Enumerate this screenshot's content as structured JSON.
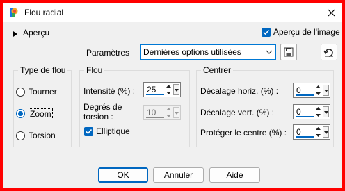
{
  "window": {
    "title": "Flou radial"
  },
  "preview": {
    "label": "Aperçu",
    "image_preview_label": "Aperçu de l'image",
    "image_preview_checked": true
  },
  "params": {
    "label": "Paramètres",
    "preset_value": "Dernières options utilisées"
  },
  "blur_type": {
    "title": "Type de flou",
    "options": [
      {
        "label": "Tourner",
        "checked": false
      },
      {
        "label": "Zoom",
        "checked": true
      },
      {
        "label": "Torsion",
        "checked": false
      }
    ]
  },
  "blur": {
    "title": "Flou",
    "intensity_label": "Intensité (%) :",
    "intensity_value": "25",
    "torsion_label_1": "Degrés de",
    "torsion_label_2": "torsion :",
    "torsion_value": "10",
    "elliptical_label": "Elliptique",
    "elliptical_checked": true
  },
  "center": {
    "title": "Centrer",
    "h_offset_label": "Décalage horiz. (%) :",
    "h_offset_value": "0",
    "v_offset_label": "Décalage vert. (%) :",
    "v_offset_value": "0",
    "protect_label": "Protéger le centre (%) :",
    "protect_value": "0"
  },
  "buttons": {
    "ok": "OK",
    "cancel": "Annuler",
    "help": "Aide"
  },
  "colors": {
    "accent": "#0067c0",
    "frame": "#ff0000",
    "dialog_bg": "#f0f0f0"
  },
  "icons": [
    "app-icon",
    "close-icon",
    "expand-arrow-icon",
    "check-icon",
    "chevron-down-icon",
    "save-preset-icon",
    "reset-icon"
  ]
}
